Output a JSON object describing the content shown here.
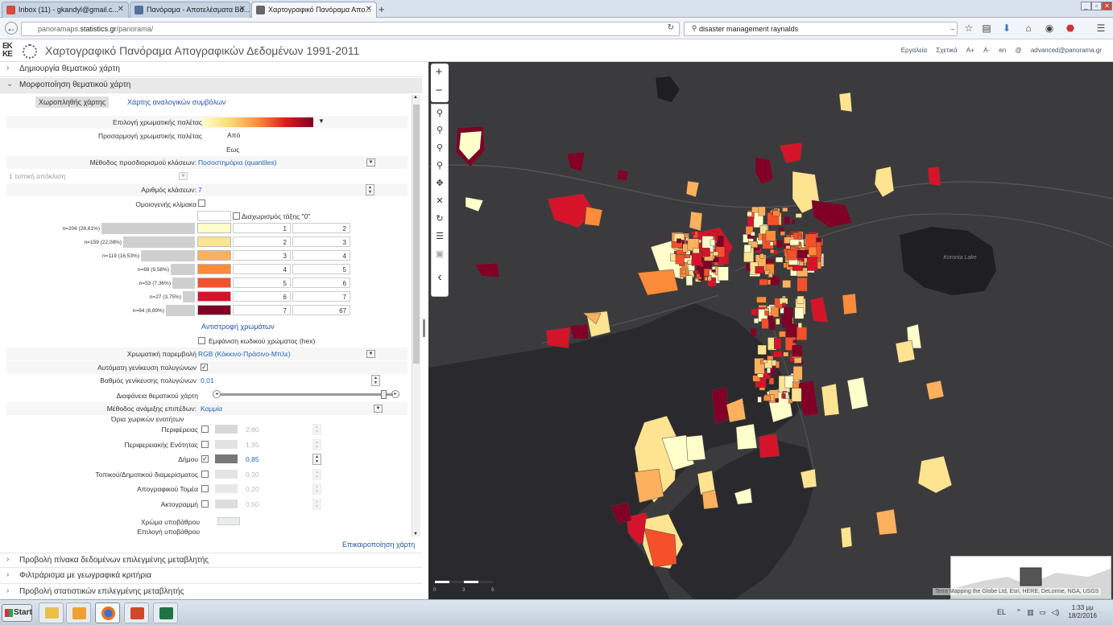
{
  "browser": {
    "tabs": [
      {
        "label": "Inbox (11) - gkandyl@gmail.c...",
        "color": "#d54b3d"
      },
      {
        "label": "Πανόραμα - Αποτελέσματα Βά...",
        "color": "#5570a0"
      },
      {
        "label": "Χαρτογραφικό Πανόραμα Απο...",
        "color": "#666666"
      }
    ],
    "url_host_prefix": "panoramaps.",
    "url_host_bold": "statistics.gr",
    "url_path": "/panorama/",
    "search_value": "disaster management raynalds"
  },
  "app": {
    "logo_line1": "ΕΚ",
    "logo_line2": "ΚΕ",
    "title": "Χαρτογραφικό Πανόραμα Απογραφικών Δεδομένων 1991-2011",
    "menu": [
      "Εργαλεία",
      "Σχετικά",
      "A+",
      "A-",
      "en",
      "@",
      "advanced@panorama.gr"
    ]
  },
  "panel": {
    "section_create": "Δημιουργία θεματικού χάρτη",
    "section_format": "Μορφοποίηση θεματικού χάρτη",
    "subtab_choropleth": "Χωροπληθής χάρτης",
    "subtab_symbols": "Χάρτης αναλογικών συμβόλων",
    "palette_label": "Επιλογή χρωματικής παλέτας",
    "adjust_label": "Προσαρμογή χρωματικής παλέτας",
    "from_label": "Από",
    "to_label": "Εως",
    "class_method_label": "Μέθοδος προσδιορισμού κλάσεων:",
    "class_method_value": "Ποσοστημόρια (quantiles)",
    "stddev_value": "1 τυπική απόκλιση",
    "num_classes_label": "Αριθμός κλάσεων:",
    "num_classes_value": "7",
    "homogeneous_label": "Ομοιογενής κλίμακα",
    "zero_class_label": "Διαχωρισμός τάξης \"0\"",
    "bins": [
      {
        "count": "n=206 (28,61%)",
        "color": "#ffffcc",
        "from": "1",
        "to": "2",
        "frac": 1.0
      },
      {
        "count": "n=159 (22,08%)",
        "color": "#fee391",
        "from": "2",
        "to": "3",
        "frac": 0.77
      },
      {
        "count": "n=119 (16,53%)",
        "color": "#fdb05e",
        "from": "3",
        "to": "4",
        "frac": 0.58
      },
      {
        "count": "n=69 (9,58%)",
        "color": "#fc8b3a",
        "from": "4",
        "to": "5",
        "frac": 0.26
      },
      {
        "count": "n=53 (7,36%)",
        "color": "#f4502b",
        "from": "5",
        "to": "6",
        "frac": 0.24
      },
      {
        "count": "n=27 (3,75%)",
        "color": "#d5142a",
        "from": "6",
        "to": "7",
        "frac": 0.13
      },
      {
        "count": "n=64 (8,89%)",
        "color": "#800026",
        "from": "7",
        "to": "67",
        "frac": 0.31
      }
    ],
    "reverse_colors": "Αντιστροφή χρωμάτων",
    "show_hex_label": "Εμφάνιση κωδικού χρώματος (hex)",
    "color_interp_label": "Χρωματική παρεμβολή",
    "color_interp_value": "RGB (Κόκκινο-Πράσινο-Μπλε)",
    "auto_generalize_label": "Αυτόματη γενίκευση πολυγώνων",
    "generalize_degree_label": "Βαθμός γενίκευσης πολυγώνων",
    "generalize_degree_value": "0,01",
    "transparency_label": "Διαφάνεια θεματικού χάρτη",
    "transparency_value": 0.95,
    "layer_update_label": "Μέθοδος ανάμιξης επιπέδων:",
    "layer_update_value": "Καμμία",
    "boundaries_title": "Όρια χωρικών ενοτήτων",
    "boundaries": [
      {
        "label": "Περιφέρειας",
        "value": "2,80",
        "checked": false,
        "swatch": "#d8d8d8"
      },
      {
        "label": "Περιφερειακής Ενότητας",
        "value": "1,95",
        "checked": false,
        "swatch": "#e2e2e2"
      },
      {
        "label": "Δήμου",
        "value": "0,85",
        "checked": true,
        "swatch": "#777777"
      },
      {
        "label": "Τοπικού/Δημοτικού διαμερίσματος",
        "value": "0,30",
        "checked": false,
        "swatch": "#e4e4e4"
      },
      {
        "label": "Απογραφικού Τομέα",
        "value": "0,20",
        "checked": false,
        "swatch": "#e8e8e8"
      },
      {
        "label": "Ακτογραμμή",
        "value": "0,50",
        "checked": false,
        "swatch": "#dddddd"
      }
    ],
    "bg_color_label": "Χρώμα υποβάθρου",
    "bg_select_label": "Επιλογή υποβάθρου",
    "update_map": "Επικαιροποίηση χάρτη",
    "section_table": "Προβολή πίνακα δεδομένων επιλεγμένης μεταβλητής",
    "section_filter": "Φιλτράρισμα με γεωγραφικά κριτήρια",
    "section_stats": "Προβολή στατιστικών επιλεγμένης μεταβλητής"
  },
  "map": {
    "lake_label": "Koronia Lake",
    "attribution": "Terra Mapping the Globe Ltd, Esri, HERE, DeLorme, NGA, USGS",
    "scale_labels": [
      "0",
      "3",
      "6"
    ]
  },
  "taskbar": {
    "start": "Start",
    "lang": "EL",
    "time": "1:33 μμ",
    "date": "18/2/2016"
  }
}
